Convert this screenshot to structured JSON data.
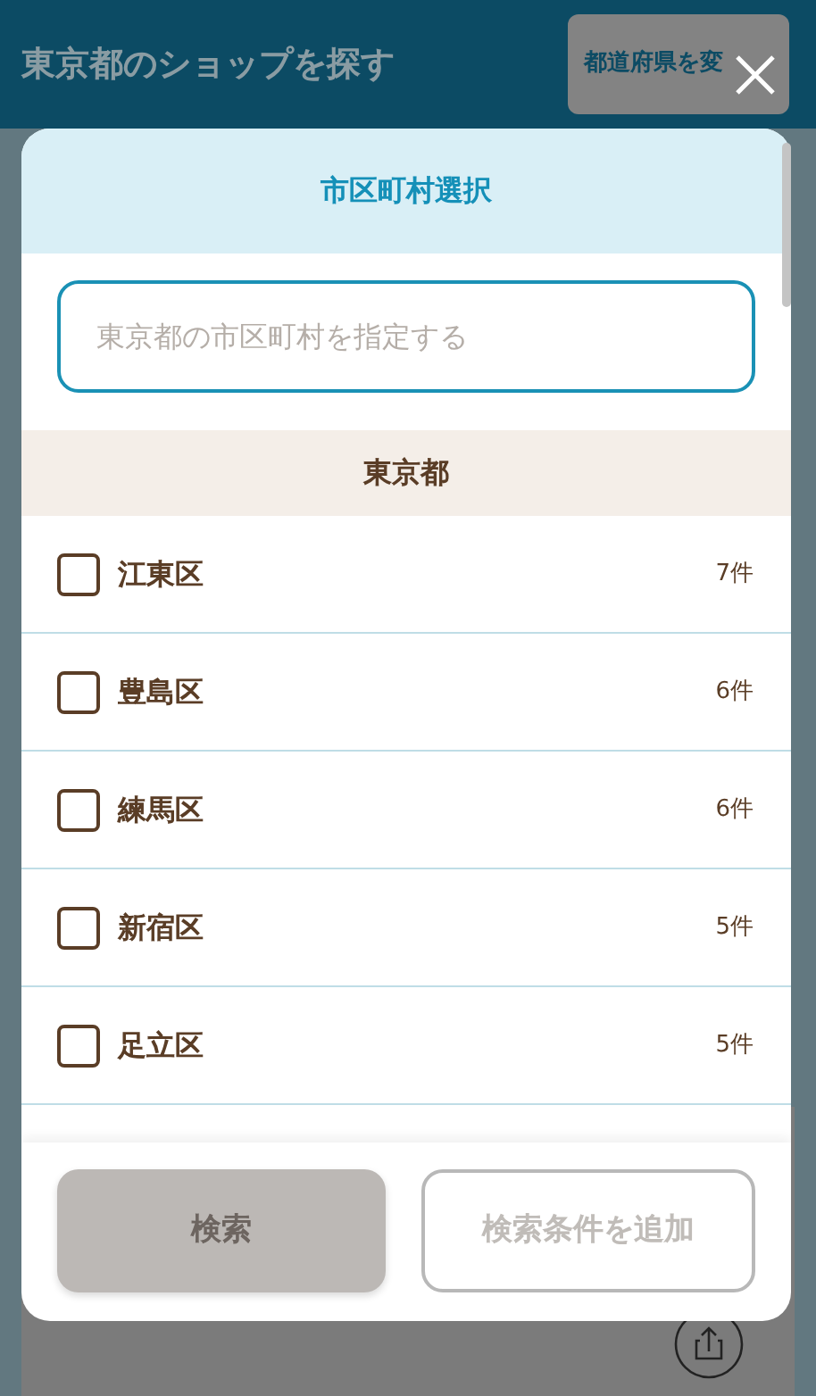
{
  "page": {
    "title": "東京都のショップを探す",
    "change_button": "都道府県を変"
  },
  "modal": {
    "title": "市区町村選択",
    "search": {
      "placeholder": "東京都の市区町村を指定する"
    },
    "section": "東京都",
    "items": [
      {
        "name": "江東区",
        "count": "7件",
        "checked": false
      },
      {
        "name": "豊島区",
        "count": "6件",
        "checked": false
      },
      {
        "name": "練馬区",
        "count": "6件",
        "checked": false
      },
      {
        "name": "新宿区",
        "count": "5件",
        "checked": false
      },
      {
        "name": "足立区",
        "count": "5件",
        "checked": false
      }
    ],
    "buttons": [
      {
        "label": "検索",
        "kind": "primary",
        "disabled": true
      },
      {
        "label": "検索条件を追加",
        "kind": "outline",
        "disabled": true
      }
    ]
  }
}
